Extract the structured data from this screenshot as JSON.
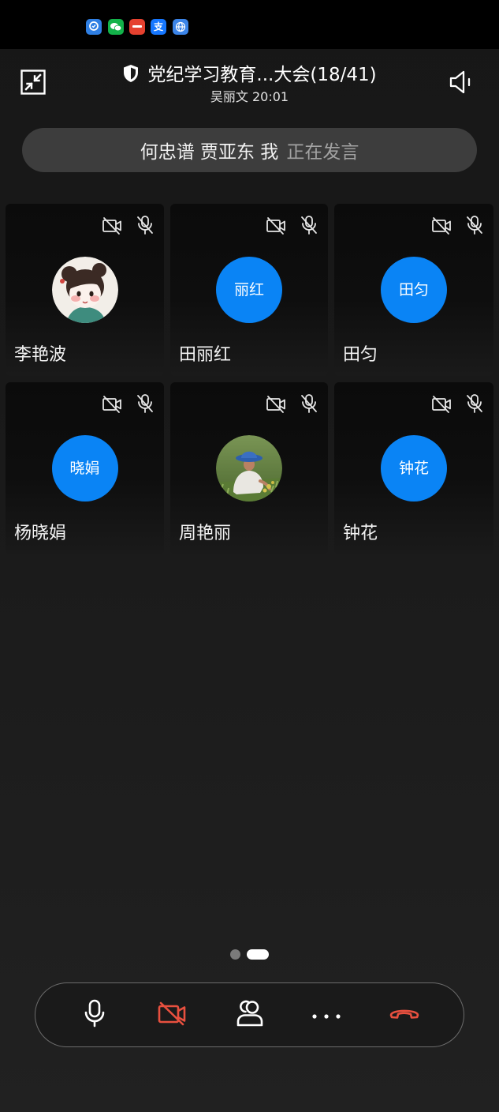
{
  "status_bar": {
    "notification_icons": [
      {
        "icon": "security-app-icon",
        "color": "#2f7fe3"
      },
      {
        "icon": "wechat-icon",
        "color": "#13b24a"
      },
      {
        "icon": "news-app-icon",
        "color": "#e5412f"
      },
      {
        "icon": "alipay-icon",
        "color": "#1677ff",
        "glyph": "支"
      },
      {
        "icon": "browser-globe-icon",
        "color": "#3b84e8"
      }
    ]
  },
  "header": {
    "minimize_icon": "minimize-icon",
    "secure_icon": "shield-icon",
    "title": "党纪学习教育...大会(18/41)",
    "subtitle": "吴丽文 20:01",
    "speaker_icon": "speaker-icon"
  },
  "speaking_banner": {
    "speakers": "何忠谱 贾亚东 我",
    "status": "正在发言"
  },
  "participants": [
    {
      "name": "李艳波",
      "camera_off": true,
      "mic_off": true
    },
    {
      "name": "田丽红",
      "avatar_text": "丽红",
      "avatar_color": "#0a84f5",
      "camera_off": true,
      "mic_off": true
    },
    {
      "name": "田匀",
      "avatar_text": "田匀",
      "avatar_color": "#0a84f5",
      "camera_off": true,
      "mic_off": true
    },
    {
      "name": "杨晓娟",
      "avatar_text": "晓娟",
      "avatar_color": "#0a84f5",
      "camera_off": true,
      "mic_off": true
    },
    {
      "name": "周艳丽",
      "camera_off": true,
      "mic_off": true
    },
    {
      "name": "钟花",
      "avatar_text": "钟花",
      "avatar_color": "#0a84f5",
      "camera_off": true,
      "mic_off": true
    }
  ],
  "pager": {
    "total_pages": 2,
    "current_page": 2
  },
  "controls": [
    {
      "icon": "microphone-icon",
      "color": "#ffffff"
    },
    {
      "icon": "camera-off-icon",
      "color": "#e8503f"
    },
    {
      "icon": "participants-icon",
      "color": "#ffffff"
    },
    {
      "icon": "more-icon",
      "color": "#ffffff"
    },
    {
      "icon": "hang-up-icon",
      "color": "#e8503f"
    }
  ],
  "colors": {
    "accent_blue": "#0a84f5",
    "alert_red": "#e8503f",
    "banner_bg": "#3d3d3d",
    "status_text_muted": "#a2a2a2"
  }
}
